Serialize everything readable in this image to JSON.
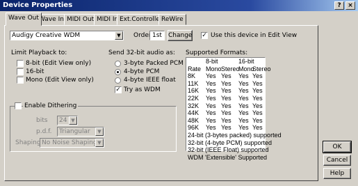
{
  "window": {
    "title": "Device Properties",
    "help_glyph": "?",
    "close_glyph": "×"
  },
  "tabs": [
    "Wave Out",
    "Wave In",
    "MIDI Out",
    "MIDI In",
    "Ext.Controller",
    "ReWire"
  ],
  "device": {
    "selected": "Audigy Creative WDM",
    "order_label": "Order",
    "order_value": "1st",
    "change_label": "Change",
    "use_label": "Use this device in Edit View"
  },
  "limit": {
    "title": "Limit Playback to:",
    "options": [
      "8-bit (Edit View only)",
      "16-bit",
      "Mono (Edit View only)"
    ]
  },
  "send32": {
    "title": "Send 32-bit audio as:",
    "options": [
      "3-byte Packed PCM",
      "4-byte PCM",
      "4-byte IEEE float"
    ],
    "selected_index": 1,
    "wdm_label": "Try as WDM"
  },
  "formats": {
    "title": "Supported Formats:",
    "head1": [
      "",
      "8-bit",
      "",
      "16-bit",
      ""
    ],
    "head2": [
      "Rate",
      "Mono",
      "Stereo",
      "Mono",
      "Stereo"
    ],
    "rows": [
      [
        "8K",
        "Yes",
        "Yes",
        "Yes",
        "Yes"
      ],
      [
        "11K",
        "Yes",
        "Yes",
        "Yes",
        "Yes"
      ],
      [
        "16K",
        "Yes",
        "Yes",
        "Yes",
        "Yes"
      ],
      [
        "22K",
        "Yes",
        "Yes",
        "Yes",
        "Yes"
      ],
      [
        "32K",
        "Yes",
        "Yes",
        "Yes",
        "Yes"
      ],
      [
        "44K",
        "Yes",
        "Yes",
        "Yes",
        "Yes"
      ],
      [
        "48K",
        "Yes",
        "Yes",
        "Yes",
        "Yes"
      ],
      [
        "96K",
        "Yes",
        "Yes",
        "Yes",
        "Yes"
      ]
    ],
    "notes": [
      "24-bit (3-bytes packed) supported",
      "32-bit (4-byte PCM) supported",
      "32-bit (IEEE Float) supported",
      "WDM 'Extensible' Supported"
    ]
  },
  "dither": {
    "enable_label": "Enable Dithering",
    "bits_label": "bits",
    "bits_value": "24",
    "pdf_label": "p.d.f.",
    "pdf_value": "Triangular",
    "shaping_label": "Shaping",
    "shaping_value": "No Noise Shaping"
  },
  "buttons": {
    "ok": "OK",
    "cancel": "Cancel",
    "help": "Help"
  }
}
